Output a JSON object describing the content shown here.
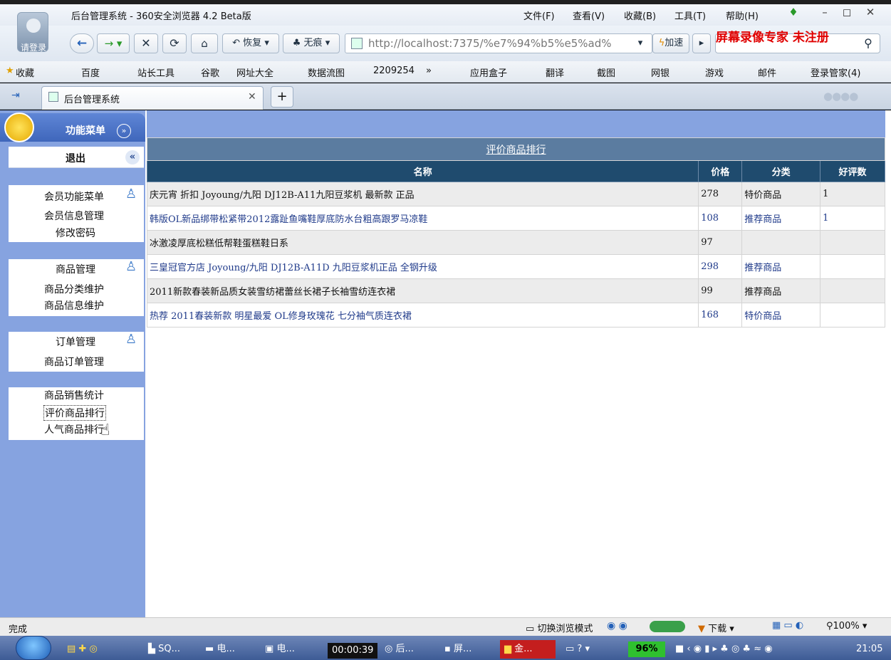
{
  "browser": {
    "title": "后台管理系统 - 360安全浏览器 4.2 Beta版",
    "login_avatar_label": "请登录",
    "menus": [
      "文件(F)",
      "查看(V)",
      "收藏(B)",
      "工具(T)",
      "帮助(H)"
    ],
    "nav": {
      "restore_label": "恢复",
      "incognito_label": "无痕",
      "accelerate_label": "加速"
    },
    "address": "http://localhost:7375/%e7%94%b5%e5%ad%",
    "watermark": "屏幕录像专家  未注册",
    "bookmarks": [
      "收藏",
      "百度",
      "站长工具",
      "谷歌",
      "网址大全",
      "数据流图",
      "2209254",
      "»",
      "应用盒子",
      "翻译",
      "截图",
      "网银",
      "游戏",
      "邮件",
      "登录管家(4)"
    ],
    "tab_title": "后台管理系统"
  },
  "sidebar": {
    "header": "功能菜单",
    "logout": "退出",
    "groups": [
      {
        "title": "会员功能菜单",
        "items": [
          "会员信息管理",
          "修改密码"
        ]
      },
      {
        "title": "商品管理",
        "items": [
          "商品分类维护",
          "商品信息维护"
        ]
      },
      {
        "title": "订单管理",
        "items": [
          "商品订单管理"
        ]
      },
      {
        "title": "",
        "items": [
          "商品销售统计",
          "评价商品排行",
          "人气商品排行"
        ]
      }
    ]
  },
  "table": {
    "caption": "评价商品排行",
    "headers": [
      "名称",
      "价格",
      "分类",
      "好评数"
    ],
    "rows": [
      [
        "庆元宵 折扣 Joyoung/九阳 DJ12B-A11九阳豆浆机 最新款 正品",
        "278",
        "特价商品",
        "1"
      ],
      [
        "韩版OL新品绑带松紧带2012露趾鱼嘴鞋厚底防水台粗高跟罗马凉鞋",
        "108",
        "推荐商品",
        "1"
      ],
      [
        "冰激凌厚底松糕低帮鞋蛋糕鞋日系",
        "97",
        "",
        ""
      ],
      [
        "三皇冠官方店 Joyoung/九阳 DJ12B-A11D 九阳豆浆机正品 全钢升级",
        "298",
        "推荐商品",
        ""
      ],
      [
        "2011新款春装新品质女装雪纺裙蕾丝长裙子长袖雪纺连衣裙",
        "99",
        "推荐商品",
        ""
      ],
      [
        "热荐 2011春装新款 明星最爱 OL修身玫瑰花 七分袖气质连衣裙",
        "168",
        "特价商品",
        ""
      ]
    ]
  },
  "status": {
    "left": "完成",
    "switch_mode": "切换浏览模式",
    "download": "下载",
    "zoom": "100%"
  },
  "taskbar": {
    "items": [
      "SQ...",
      "电...",
      "电...",
      "00:00:39",
      "后...",
      "屏...",
      "金..."
    ],
    "battery": "96%",
    "clock": "21:05"
  }
}
